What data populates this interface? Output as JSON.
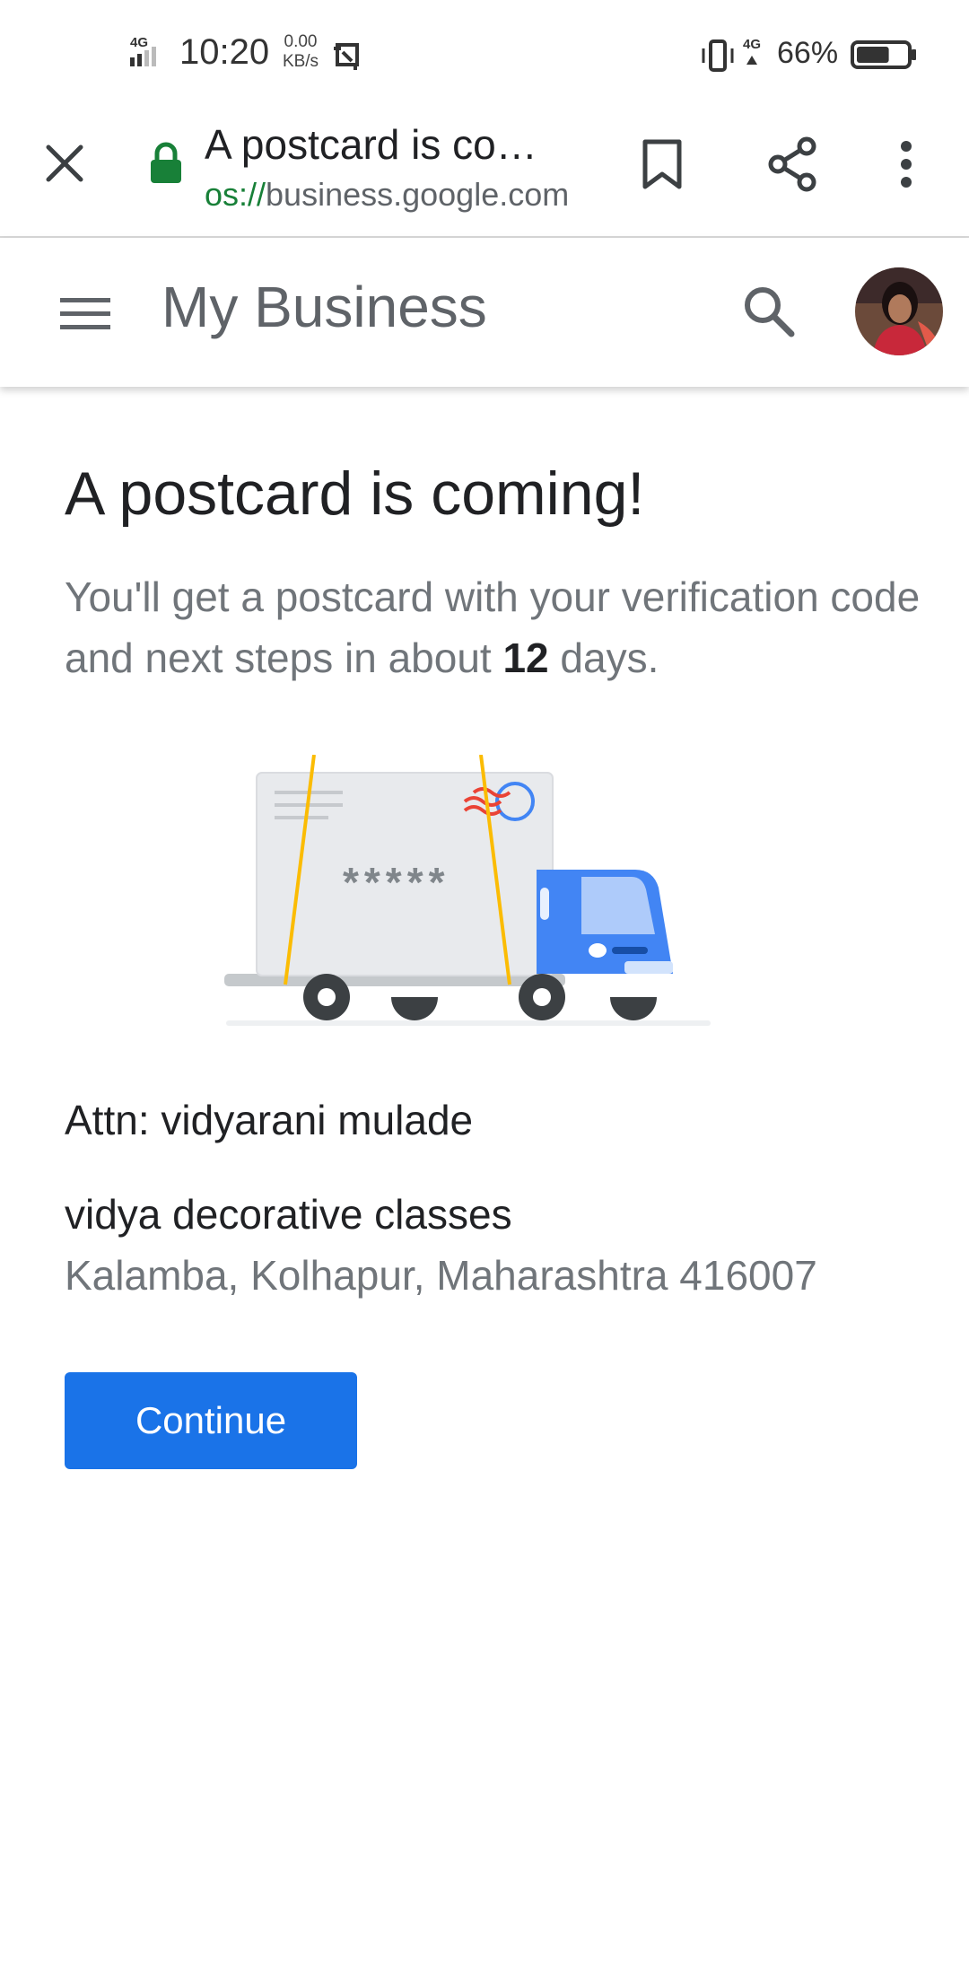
{
  "status_bar": {
    "network_left": "4G",
    "time": "10:20",
    "speed_value": "0.00",
    "speed_unit": "KB/s",
    "network_right": "4G",
    "battery_percent": "66%",
    "battery_level": 0.66
  },
  "browser_toolbar": {
    "page_title": "A postcard is co…",
    "url_scheme": "os://",
    "url_host": "business.google.com",
    "icons": [
      "close-icon",
      "lock-icon",
      "bookmark-icon",
      "share-icon",
      "more-vert-icon"
    ]
  },
  "app_header": {
    "title": "My Business",
    "icons": [
      "menu-icon",
      "search-icon",
      "avatar"
    ]
  },
  "main": {
    "heading": "A postcard is coming!",
    "description_before": "You'll get a postcard with your verification code and next steps in about ",
    "description_days": "12",
    "description_after": " days.",
    "illustration_code": "*****",
    "attn": "Attn: vidyarani mulade",
    "business_name": "vidya decorative classes",
    "address": "Kalamba, Kolhapur, Maharashtra 416007",
    "continue_label": "Continue"
  },
  "colors": {
    "primary_button": "#1a73e8",
    "lock_green": "#188038",
    "header_text": "#5f6368",
    "secondary_text": "#70757a",
    "truck_blue": "#4285f4"
  }
}
